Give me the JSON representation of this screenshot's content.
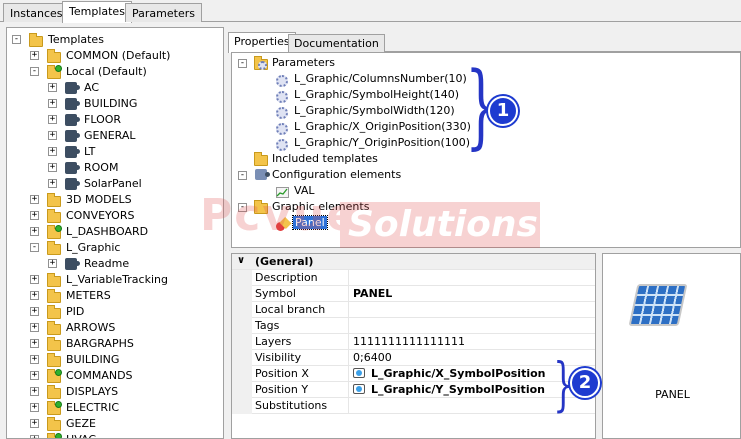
{
  "top_tabs": [
    "Instances",
    "Templates",
    "Parameters"
  ],
  "active_top_tab": 1,
  "tree": [
    {
      "label": "Templates",
      "level": 0,
      "icon": "folder",
      "exp": "-"
    },
    {
      "label": "COMMON (Default)",
      "level": 1,
      "icon": "folder",
      "exp": "+"
    },
    {
      "label": "Local (Default)",
      "level": 1,
      "icon": "folder-green",
      "exp": "-"
    },
    {
      "label": "AC",
      "level": 2,
      "icon": "puzzle",
      "exp": "+"
    },
    {
      "label": "BUILDING",
      "level": 2,
      "icon": "puzzle",
      "exp": "+"
    },
    {
      "label": "FLOOR",
      "level": 2,
      "icon": "puzzle",
      "exp": "+"
    },
    {
      "label": "GENERAL",
      "level": 2,
      "icon": "puzzle",
      "exp": "+"
    },
    {
      "label": "LT",
      "level": 2,
      "icon": "puzzle",
      "exp": "+"
    },
    {
      "label": "ROOM",
      "level": 2,
      "icon": "puzzle",
      "exp": "+"
    },
    {
      "label": "SolarPanel",
      "level": 2,
      "icon": "puzzle",
      "exp": "+"
    },
    {
      "label": "3D MODELS",
      "level": 1,
      "icon": "folder",
      "exp": "+"
    },
    {
      "label": "CONVEYORS",
      "level": 1,
      "icon": "folder",
      "exp": "+"
    },
    {
      "label": "L_DASHBOARD",
      "level": 1,
      "icon": "folder-green",
      "exp": "+"
    },
    {
      "label": "L_Graphic",
      "level": 1,
      "icon": "folder",
      "exp": "-"
    },
    {
      "label": "Readme",
      "level": 2,
      "icon": "puzzle",
      "exp": "+"
    },
    {
      "label": "L_VariableTracking",
      "level": 1,
      "icon": "folder",
      "exp": "+"
    },
    {
      "label": "METERS",
      "level": 1,
      "icon": "folder",
      "exp": "+"
    },
    {
      "label": "PID",
      "level": 1,
      "icon": "folder",
      "exp": "+"
    },
    {
      "label": "ARROWS",
      "level": 1,
      "icon": "folder",
      "exp": "+"
    },
    {
      "label": "BARGRAPHS",
      "level": 1,
      "icon": "folder",
      "exp": "+"
    },
    {
      "label": "BUILDING",
      "level": 1,
      "icon": "folder",
      "exp": "+"
    },
    {
      "label": "COMMANDS",
      "level": 1,
      "icon": "folder-green",
      "exp": "+"
    },
    {
      "label": "DISPLAYS",
      "level": 1,
      "icon": "folder",
      "exp": "+"
    },
    {
      "label": "ELECTRIC",
      "level": 1,
      "icon": "folder-green",
      "exp": "+"
    },
    {
      "label": "GEZE",
      "level": 1,
      "icon": "folder",
      "exp": "+"
    },
    {
      "label": "HVAC",
      "level": 1,
      "icon": "folder-green",
      "exp": "+"
    }
  ],
  "right_tabs": [
    "Properties",
    "Documentation"
  ],
  "prop_tree": {
    "parameters_label": "Parameters",
    "parameters": [
      "L_Graphic/ColumnsNumber(10)",
      "L_Graphic/SymbolHeight(140)",
      "L_Graphic/SymbolWidth(120)",
      "L_Graphic/X_OriginPosition(330)",
      "L_Graphic/Y_OriginPosition(100)"
    ],
    "included_label": "Included templates",
    "config_label": "Configuration elements",
    "config_child": "VAL",
    "graphic_label": "Graphic elements",
    "graphic_child": "Panel"
  },
  "watermark": {
    "left": "Pcvue",
    "right": "Solutions"
  },
  "badges": [
    "1",
    "2"
  ],
  "grid": {
    "category": "(General)",
    "rows": [
      {
        "label": "Description",
        "value": "",
        "bold": false,
        "icon": false
      },
      {
        "label": "Symbol",
        "value": "PANEL",
        "bold": true,
        "icon": false
      },
      {
        "label": "Local branch",
        "value": "",
        "bold": false,
        "icon": false
      },
      {
        "label": "Tags",
        "value": "",
        "bold": false,
        "icon": false
      },
      {
        "label": "Layers",
        "value": "1111111111111111",
        "bold": false,
        "icon": false
      },
      {
        "label": "Visibility",
        "value": "0;6400",
        "bold": false,
        "icon": false
      },
      {
        "label": "Position X",
        "value": "L_Graphic/X_SymbolPosition",
        "bold": true,
        "icon": true
      },
      {
        "label": "Position Y",
        "value": "L_Graphic/Y_SymbolPosition",
        "bold": true,
        "icon": true
      },
      {
        "label": "Substitutions",
        "value": "",
        "bold": false,
        "icon": false
      }
    ]
  },
  "preview_label": "PANEL",
  "colors": {
    "accent": "#1e3bd0",
    "selection": "#2f72d8"
  }
}
